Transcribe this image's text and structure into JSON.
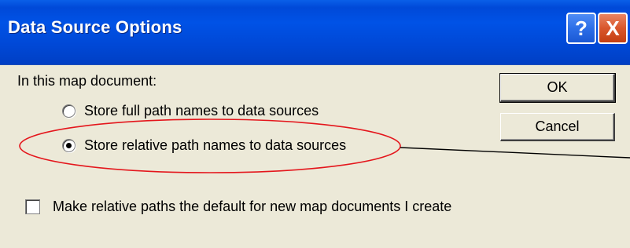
{
  "window": {
    "title": "Data Source Options",
    "help_label": "?",
    "close_label": "X"
  },
  "options": {
    "group_label": "In this map document:",
    "radio_full": "Store full path names to data sources",
    "radio_relative": "Store relative path names to data sources",
    "selected": "relative",
    "checkbox_label": "Make relative paths the default for new map documents I create",
    "checkbox_checked": false
  },
  "buttons": {
    "ok": "OK",
    "cancel": "Cancel"
  },
  "annotation": {
    "color": "#e4161c",
    "target": "radio_relative"
  }
}
